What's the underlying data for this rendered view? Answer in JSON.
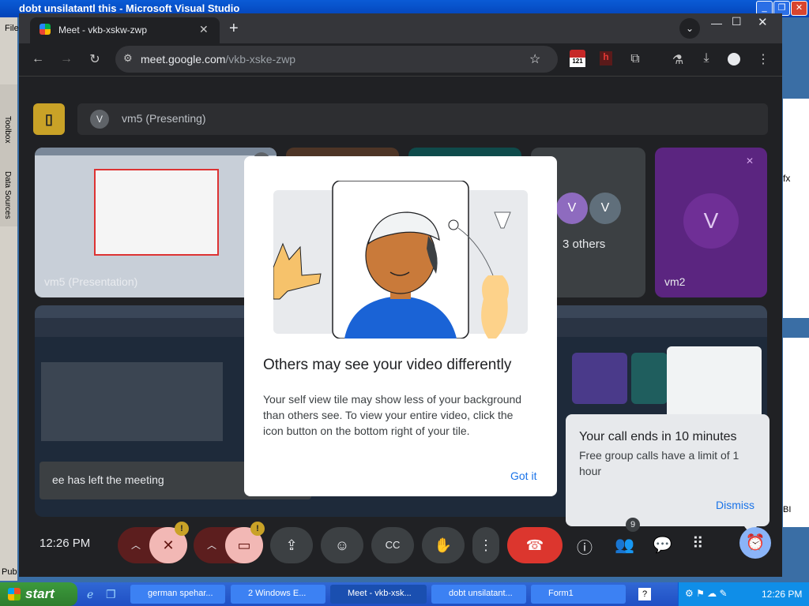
{
  "vs": {
    "title": "dobt unsilatantl this - Microsoft Visual Studio",
    "file_menu": "File",
    "toolbox": "Toolbox",
    "data_sources": "Data Sources",
    "fx": "fx",
    "bi": "BI",
    "pub": "Pub"
  },
  "browser": {
    "tab_title": "Meet - vkb-xskw-zwp",
    "url_host": "meet.google.com",
    "url_path": "/vkb-xske-zwp",
    "extension_badge": "121"
  },
  "meet": {
    "presenting_label": "vm5 (Presenting)",
    "presenting_avatar": "V",
    "others_label": "3 others",
    "others_avatar_1": "V",
    "others_avatar_2": "V",
    "vm2_label": "vm2",
    "vm2_avatar": "V",
    "presentation_caption": "vm5 (Presentation)",
    "left_meeting_toast": "ee has left the meeting",
    "clock": "12:26 PM",
    "people_badge": "9",
    "alert_mark_1": "!",
    "alert_mark_2": "!"
  },
  "modal": {
    "title": "Others may see your video differently",
    "body": "Your self view tile may show less of your background than others see. To view your entire video, click the icon button on the bottom right of your tile.",
    "button": "Got it"
  },
  "notice": {
    "title": "Your call ends in 10 minutes",
    "body": "Free group calls have a limit of 1 hour",
    "dismiss": "Dismiss"
  },
  "taskbar": {
    "start": "start",
    "items": [
      "german spehar...",
      "2 Windows E...",
      "Meet - vkb-xsk...",
      "dobt unsilatant...",
      "Form1"
    ],
    "time": "12:26 PM"
  }
}
